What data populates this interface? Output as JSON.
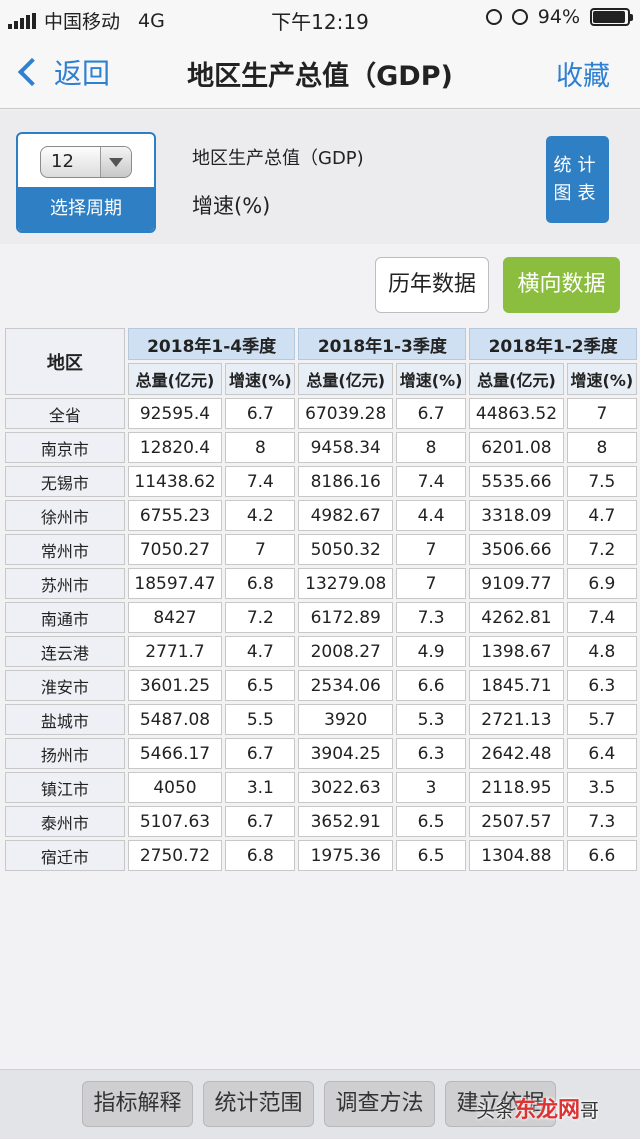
{
  "status": {
    "carrier": "中国移动",
    "network": "4G",
    "time": "下午12:19",
    "battery": "94%",
    "battery_level": 0.94
  },
  "nav": {
    "back_label": "返回",
    "title": "地区生产总值（GDP)",
    "favorite_label": "收藏"
  },
  "controls": {
    "period_value": "12",
    "period_label": "选择周期",
    "indicator_title": "地区生产总值（GDP)",
    "indicator_sub": "增速(%)",
    "chart_button_line1": "统计",
    "chart_button_line2": "图表"
  },
  "toggles": {
    "yearly": "历年数据",
    "horizontal": "横向数据"
  },
  "table": {
    "region_header": "地区",
    "periods": [
      "2018年1-4季度",
      "2018年1-3季度",
      "2018年1-2季度"
    ],
    "sub_total": "总量(亿元)",
    "sub_rate": "增速(%)",
    "rows": [
      {
        "region": "全省",
        "v": [
          "92595.4",
          "6.7",
          "67039.28",
          "6.7",
          "44863.52",
          "7"
        ]
      },
      {
        "region": "南京市",
        "v": [
          "12820.4",
          "8",
          "9458.34",
          "8",
          "6201.08",
          "8"
        ]
      },
      {
        "region": "无锡市",
        "v": [
          "11438.62",
          "7.4",
          "8186.16",
          "7.4",
          "5535.66",
          "7.5"
        ]
      },
      {
        "region": "徐州市",
        "v": [
          "6755.23",
          "4.2",
          "4982.67",
          "4.4",
          "3318.09",
          "4.7"
        ]
      },
      {
        "region": "常州市",
        "v": [
          "7050.27",
          "7",
          "5050.32",
          "7",
          "3506.66",
          "7.2"
        ]
      },
      {
        "region": "苏州市",
        "v": [
          "18597.47",
          "6.8",
          "13279.08",
          "7",
          "9109.77",
          "6.9"
        ]
      },
      {
        "region": "南通市",
        "v": [
          "8427",
          "7.2",
          "6172.89",
          "7.3",
          "4262.81",
          "7.4"
        ]
      },
      {
        "region": "连云港",
        "v": [
          "2771.7",
          "4.7",
          "2008.27",
          "4.9",
          "1398.67",
          "4.8"
        ]
      },
      {
        "region": "淮安市",
        "v": [
          "3601.25",
          "6.5",
          "2534.06",
          "6.6",
          "1845.71",
          "6.3"
        ]
      },
      {
        "region": "盐城市",
        "v": [
          "5487.08",
          "5.5",
          "3920",
          "5.3",
          "2721.13",
          "5.7"
        ]
      },
      {
        "region": "扬州市",
        "v": [
          "5466.17",
          "6.7",
          "3904.25",
          "6.3",
          "2642.48",
          "6.4"
        ]
      },
      {
        "region": "镇江市",
        "v": [
          "4050",
          "3.1",
          "3022.63",
          "3",
          "2118.95",
          "3.5"
        ]
      },
      {
        "region": "泰州市",
        "v": [
          "5107.63",
          "6.7",
          "3652.91",
          "6.5",
          "2507.57",
          "7.3"
        ]
      },
      {
        "region": "宿迁市",
        "v": [
          "2750.72",
          "6.8",
          "1975.36",
          "6.5",
          "1304.88",
          "6.6"
        ]
      }
    ]
  },
  "bottom": {
    "buttons": [
      "指标解释",
      "统计范围",
      "调查方法",
      "建立依据"
    ]
  },
  "watermark": {
    "prefix": "头条",
    "brand": "东龙网",
    "suffix": "哥"
  }
}
